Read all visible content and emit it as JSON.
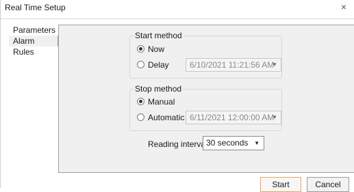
{
  "window": {
    "title": "Real Time Setup",
    "close_glyph": "×"
  },
  "nav": {
    "items": [
      {
        "label": "Parameters"
      },
      {
        "label": "Alarm Rules"
      }
    ]
  },
  "start_method": {
    "title": "Start method",
    "options": [
      {
        "label": "Now",
        "checked": true
      },
      {
        "label": "Delay",
        "checked": false
      }
    ],
    "delay_datetime": "6/10/2021 11:21:56 AM"
  },
  "stop_method": {
    "title": "Stop method",
    "options": [
      {
        "label": "Manual",
        "checked": true
      },
      {
        "label": "Automatic",
        "checked": false
      }
    ],
    "automatic_datetime": "6/11/2021 12:00:00 AM"
  },
  "reading_interval": {
    "label": "Reading interval:",
    "value": "30 seconds"
  },
  "buttons": {
    "start": "Start",
    "cancel": "Cancel"
  },
  "icons": {
    "dropdown": "chevron-down-icon",
    "close": "close-icon"
  },
  "colors": {
    "focus_border": "#e8a560",
    "panel_bg": "#f0f0f0"
  }
}
